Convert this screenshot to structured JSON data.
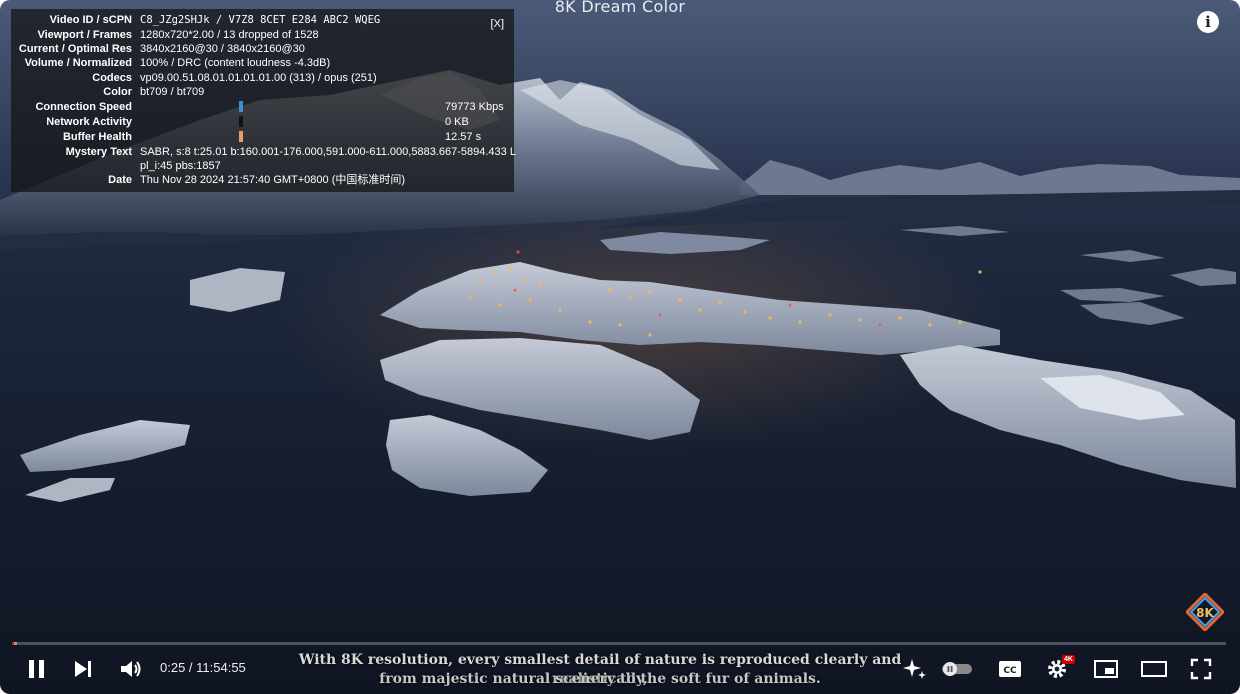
{
  "video": {
    "title": "8K Dream Color"
  },
  "stats": {
    "close_label": "[X]",
    "rows": [
      {
        "label": "Video ID / sCPN",
        "value": "C8_JZg2SHJk / V7Z8 8CET E284 ABC2 WQEG"
      },
      {
        "label": "Viewport / Frames",
        "value": "1280x720*2.00 / 13 dropped of 1528"
      },
      {
        "label": "Current / Optimal Res",
        "value": "3840x2160@30 / 3840x2160@30"
      },
      {
        "label": "Volume / Normalized",
        "value": "100% / DRC (content loudness -4.3dB)"
      },
      {
        "label": "Codecs",
        "value": "vp09.00.51.08.01.01.01.01.00 (313) / opus (251)"
      },
      {
        "label": "Color",
        "value": "bt709 / bt709"
      },
      {
        "label": "Connection Speed",
        "value": "79773 Kbps",
        "bar_color": "#3b8fd9"
      },
      {
        "label": "Network Activity",
        "value": "0 KB",
        "bar_color": "#111111"
      },
      {
        "label": "Buffer Health",
        "value": "12.57 s",
        "bar_color": "#e8a05a"
      },
      {
        "label": "Mystery Text",
        "value": "SABR, s:8 t:25.01 b:160.001-176.000,591.000-611.000,5883.667-5894.433 L",
        "value2": "pl_i:45 pbs:1857"
      },
      {
        "label": "Date",
        "value": "Thu Nov 28 2024 21:57:40 GMT+0800 (中国标准时间)"
      }
    ]
  },
  "controls": {
    "time_display": "0:25 / 11:54:55",
    "progress_played_fraction": 0.0006,
    "progress_loaded_fraction": 0.004,
    "quality_badge": "4K",
    "badge_text": "8K"
  },
  "captions": {
    "line1": "With 8K resolution, every smallest detail of nature is reproduced clearly and realistically,",
    "line2": "from majestic natural scenery to the soft fur of animals."
  },
  "colors": {
    "accent": "#ff0000",
    "quality_badge": "#cc0000"
  }
}
